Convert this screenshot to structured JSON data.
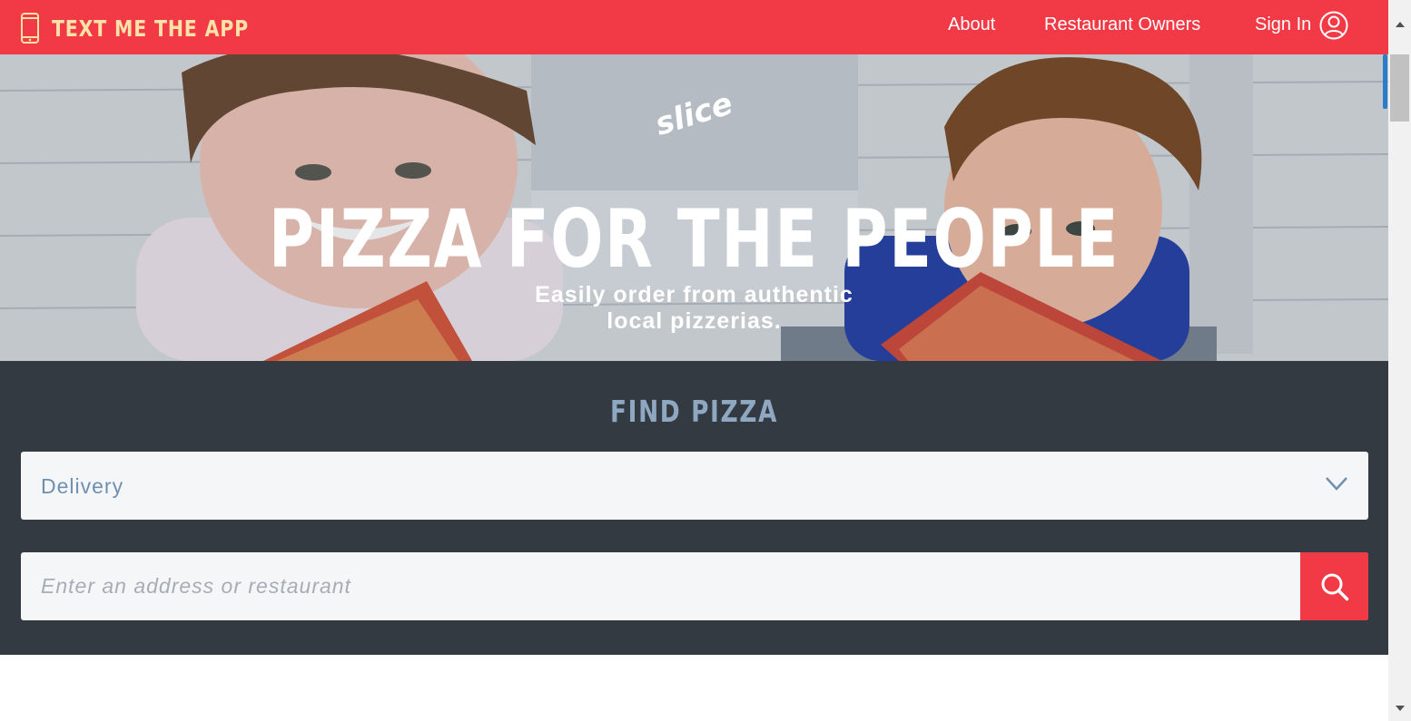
{
  "header": {
    "text_app_label": "TEXT ME THE APP",
    "nav": {
      "about": "About",
      "restaurant_owners": "Restaurant Owners",
      "sign_in": "Sign In"
    }
  },
  "hero": {
    "logo_text": "slice",
    "title": "PIZZA FOR THE PEOPLE",
    "subtitle_line1": "Easily order from authentic",
    "subtitle_line2": "local pizzerias."
  },
  "find": {
    "title": "FIND PIZZA",
    "order_type": "Delivery",
    "search_placeholder": "Enter an address or restaurant"
  },
  "colors": {
    "brand_red": "#f13a45",
    "header_text": "#ffe2a8",
    "panel_bg": "#343a42",
    "find_title": "#8fa8c2",
    "select_text": "#6f90b0"
  },
  "icons": {
    "phone": "phone-icon",
    "user": "user-icon",
    "chevron": "chevron-down-icon",
    "search": "search-icon"
  }
}
